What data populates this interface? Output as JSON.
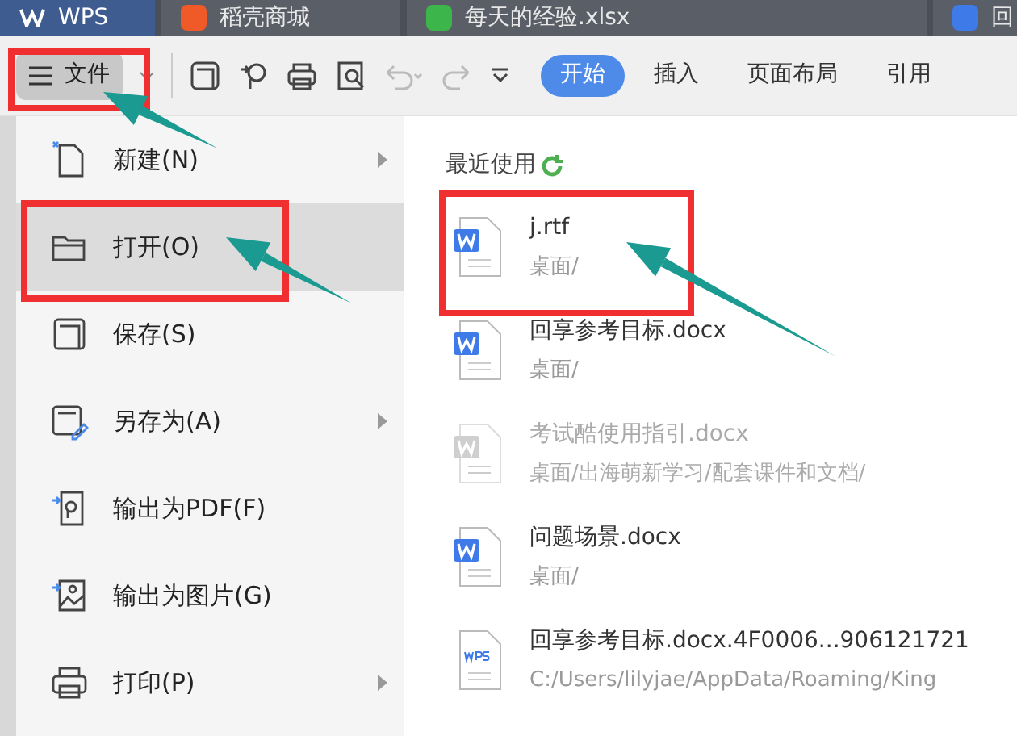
{
  "doc_tabs": [
    {
      "label": "WPS",
      "kind": "wps",
      "selected": true
    },
    {
      "label": "稻壳商城",
      "kind": "docer",
      "selected": false
    },
    {
      "label": "每天的经验.xlsx",
      "kind": "sheet",
      "selected": false
    },
    {
      "label": "回",
      "kind": "writer",
      "selected": false
    }
  ],
  "toolbar": {
    "file_button": "文件",
    "ribbon_tabs": [
      {
        "label": "开始",
        "selected": true
      },
      {
        "label": "插入",
        "selected": false
      },
      {
        "label": "页面布局",
        "selected": false
      },
      {
        "label": "引用",
        "selected": false
      }
    ]
  },
  "file_menu": [
    {
      "label": "新建(N)",
      "kind": "new",
      "submenu": true,
      "selected": false
    },
    {
      "label": "打开(O)",
      "kind": "open",
      "submenu": false,
      "selected": true
    },
    {
      "label": "保存(S)",
      "kind": "save",
      "submenu": false,
      "selected": false
    },
    {
      "label": "另存为(A)",
      "kind": "saveas",
      "submenu": true,
      "selected": false
    },
    {
      "label": "输出为PDF(F)",
      "kind": "pdf",
      "submenu": false,
      "selected": false
    },
    {
      "label": "输出为图片(G)",
      "kind": "image",
      "submenu": false,
      "selected": false
    },
    {
      "label": "打印(P)",
      "kind": "print",
      "submenu": true,
      "selected": false
    }
  ],
  "recent": {
    "title": "最近使用",
    "files": [
      {
        "name": "j.rtf",
        "path": "桌面/",
        "kind": "word",
        "disabled": false
      },
      {
        "name": "回享参考目标.docx",
        "path": "桌面/",
        "kind": "word",
        "disabled": false
      },
      {
        "name": "考试酷使用指引.docx",
        "path": "桌面/出海萌新学习/配套课件和文档/",
        "kind": "word",
        "disabled": true
      },
      {
        "name": "问题场景.docx",
        "path": "桌面/",
        "kind": "word",
        "disabled": false
      },
      {
        "name": "回享参考目标.docx.4F0006...906121721",
        "path": "C:/Users/lilyjae/AppData/Roaming/King",
        "kind": "wps",
        "disabled": false
      }
    ]
  }
}
